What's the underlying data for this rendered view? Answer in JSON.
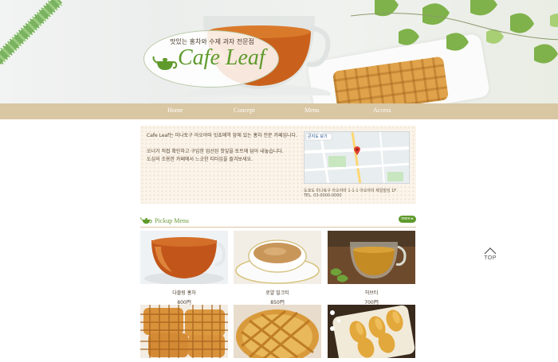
{
  "hero": {
    "tagline": "맛있는 홍차와 수제 과자 전문점",
    "logo_text": "Cafe Leaf"
  },
  "nav": {
    "items": [
      {
        "label": "Home"
      },
      {
        "label": "Concept"
      },
      {
        "label": "Menu"
      },
      {
        "label": "Access"
      }
    ]
  },
  "info": {
    "line1": "Cafe Leaf는 미나토구 아오야마 잇쵸메역 앞에 있는 홍차 전문 카페입니다.",
    "line2": "오너가 직접 확인하고 구입한 엄선된 찻잎을 토트에 담아 내놓습니다.",
    "line3": "도심의 조용한 카페에서 느긋한 티타임을 즐겨보세요.",
    "map_label": "큰지도 보기",
    "address": "도쿄도 미나토구 아오야마 1-1-1 아오야마 제일빌딩 1F",
    "tel": "TEL. 03-0000-0000"
  },
  "pickup": {
    "title": "Pickup Menu",
    "more_label": "more"
  },
  "menu": [
    {
      "name": "다즐링 홍차",
      "price": "800円"
    },
    {
      "name": "로얄 밀크티",
      "price": "850円"
    },
    {
      "name": "허브티",
      "price": "700円"
    },
    {
      "name": "",
      "price": ""
    },
    {
      "name": "",
      "price": ""
    },
    {
      "name": "",
      "price": ""
    }
  ],
  "top_button": {
    "label": "TOP"
  },
  "colors": {
    "accent_green": "#5f9a2c",
    "nav_beige": "#d9c6a2",
    "tea_amber": "#c9611c"
  }
}
